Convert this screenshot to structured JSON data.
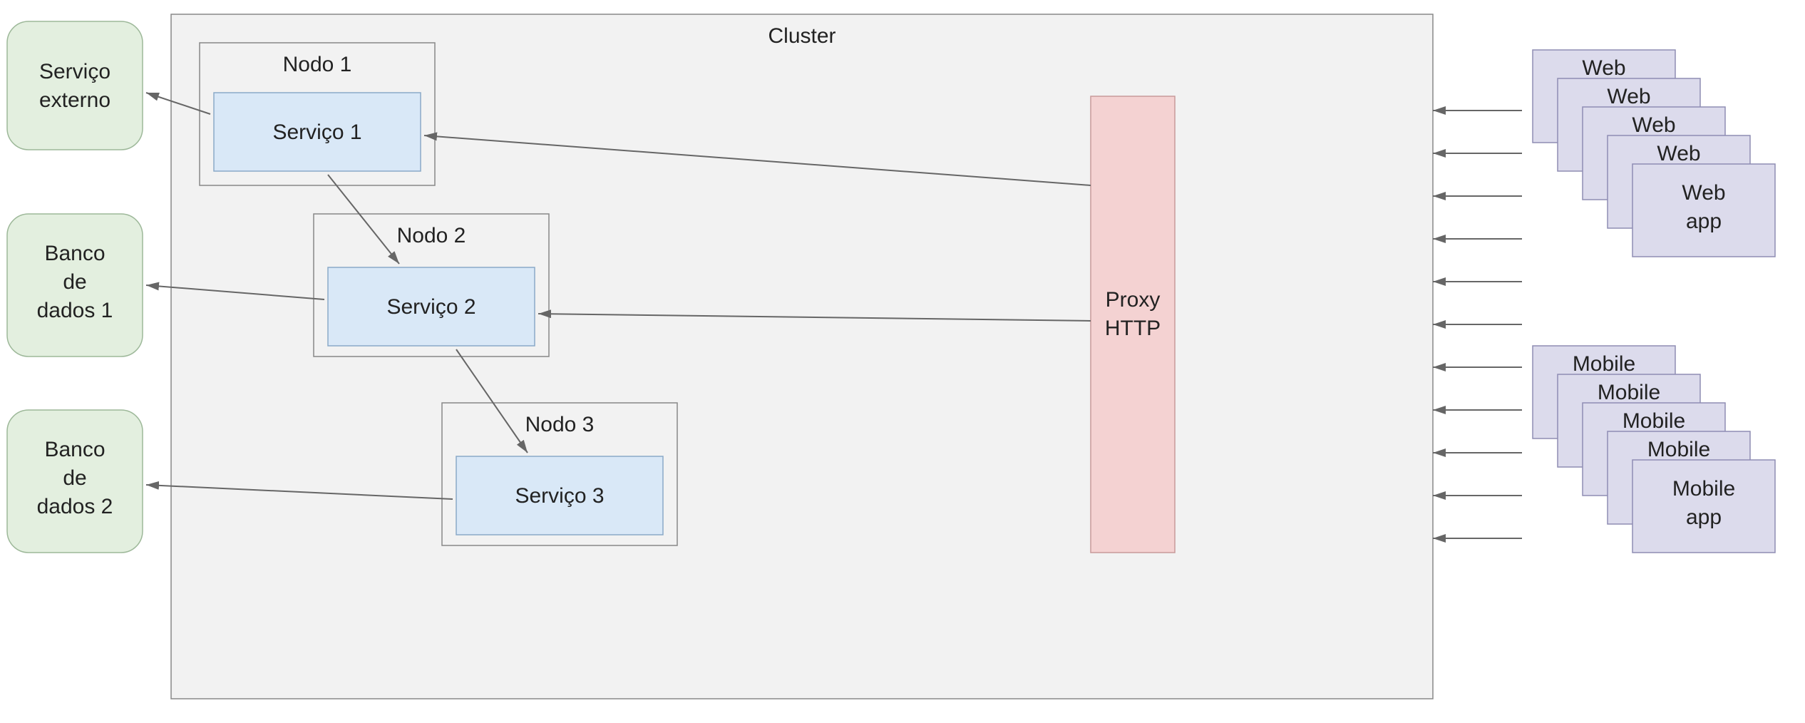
{
  "cluster": {
    "title": "Cluster"
  },
  "nodes": {
    "n1": {
      "title": "Nodo 1",
      "service": "Serviço 1"
    },
    "n2": {
      "title": "Nodo 2",
      "service": "Serviço 2"
    },
    "n3": {
      "title": "Nodo 3",
      "service": "Serviço 3"
    }
  },
  "proxy": {
    "line1": "Proxy",
    "line2": "HTTP"
  },
  "external": {
    "svc": {
      "line1": "Serviço",
      "line2": "externo"
    },
    "db1": {
      "line1": "Banco",
      "line2": "de",
      "line3": "dados 1"
    },
    "db2": {
      "line1": "Banco",
      "line2": "de",
      "line3": "dados 2"
    }
  },
  "clients": {
    "web": {
      "partial": "Web",
      "full1": "Web",
      "full2": "app"
    },
    "mobile": {
      "partial": "Mobile",
      "full1": "Mobile",
      "full2": "app"
    }
  }
}
